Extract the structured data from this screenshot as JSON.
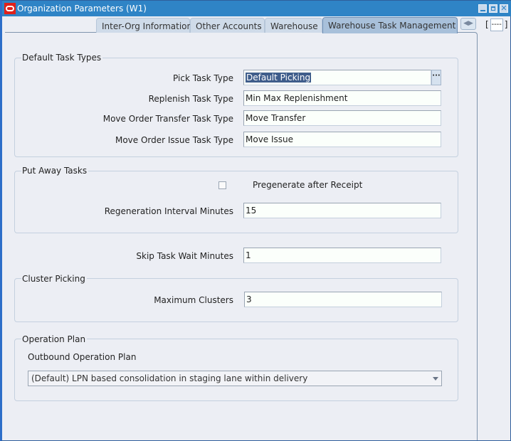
{
  "window": {
    "title": "Organization Parameters (W1)",
    "controls": {
      "minimize": "minimize",
      "maximize": "maximize",
      "close": "✕"
    }
  },
  "tabs": [
    {
      "label": "Inter-Org Information",
      "active": false
    },
    {
      "label": "Other Accounts",
      "active": false
    },
    {
      "label": "Warehouse",
      "active": false
    },
    {
      "label": "Warehouse Task Management",
      "active": true
    }
  ],
  "tab_scroll": "◀▶",
  "tab_extra": {
    "open": "[",
    "value": "----",
    "close": "]"
  },
  "default_task_types": {
    "title": "Default Task Types",
    "pick_label": "Pick Task Type",
    "pick_value": "Default Picking",
    "lov": "···",
    "replenish_label": "Replenish Task Type",
    "replenish_value": "Min Max Replenishment",
    "transfer_label": "Move Order Transfer Task Type",
    "transfer_value": "Move Transfer",
    "issue_label": "Move Order Issue Task Type",
    "issue_value": "Move Issue"
  },
  "put_away": {
    "title": "Put Away Tasks",
    "pregenerate_label": "Pregenerate after Receipt",
    "pregenerate_checked": false,
    "regen_label": "Regeneration Interval Minutes",
    "regen_value": "15"
  },
  "skip_task": {
    "label": "Skip Task Wait Minutes",
    "value": "1"
  },
  "cluster": {
    "title": "Cluster Picking",
    "max_label": "Maximum Clusters",
    "max_value": "3"
  },
  "operation_plan": {
    "title": "Operation Plan",
    "outbound_label": "Outbound Operation Plan",
    "outbound_value": "(Default) LPN based consolidation in staging lane within delivery"
  }
}
